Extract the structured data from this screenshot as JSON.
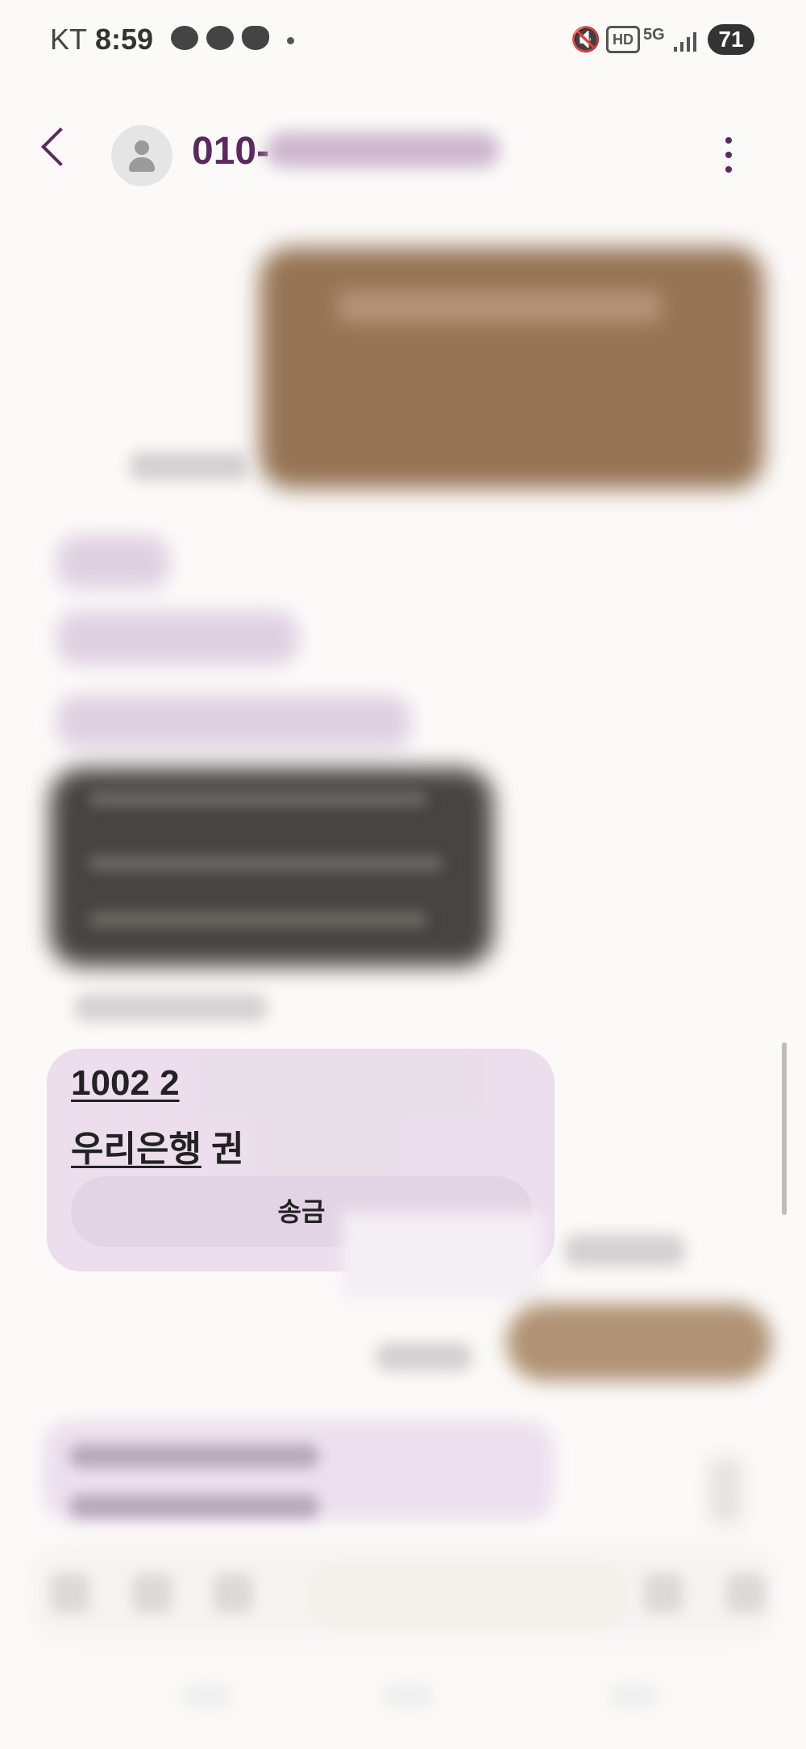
{
  "status_bar": {
    "carrier": "KT",
    "time": "8:59",
    "battery": "71",
    "icons": [
      "kakaotalk-icon",
      "chat-icon",
      "weather-icon",
      "mute-icon",
      "hd-icon",
      "5g-icon",
      "signal-icon",
      "battery-icon"
    ]
  },
  "header": {
    "contact_visible": "010-",
    "icons": [
      "back-icon",
      "avatar-icon",
      "more-icon"
    ]
  },
  "message": {
    "account_prefix": "1002 2",
    "bank_name": "우리은행",
    "holder_prefix": " 권",
    "send_button": "송금"
  },
  "colors": {
    "accent": "#5a2a5c",
    "sent_bubble": "#977455",
    "received_bubble": "#ecdeed",
    "background": "#fbfaf9"
  }
}
